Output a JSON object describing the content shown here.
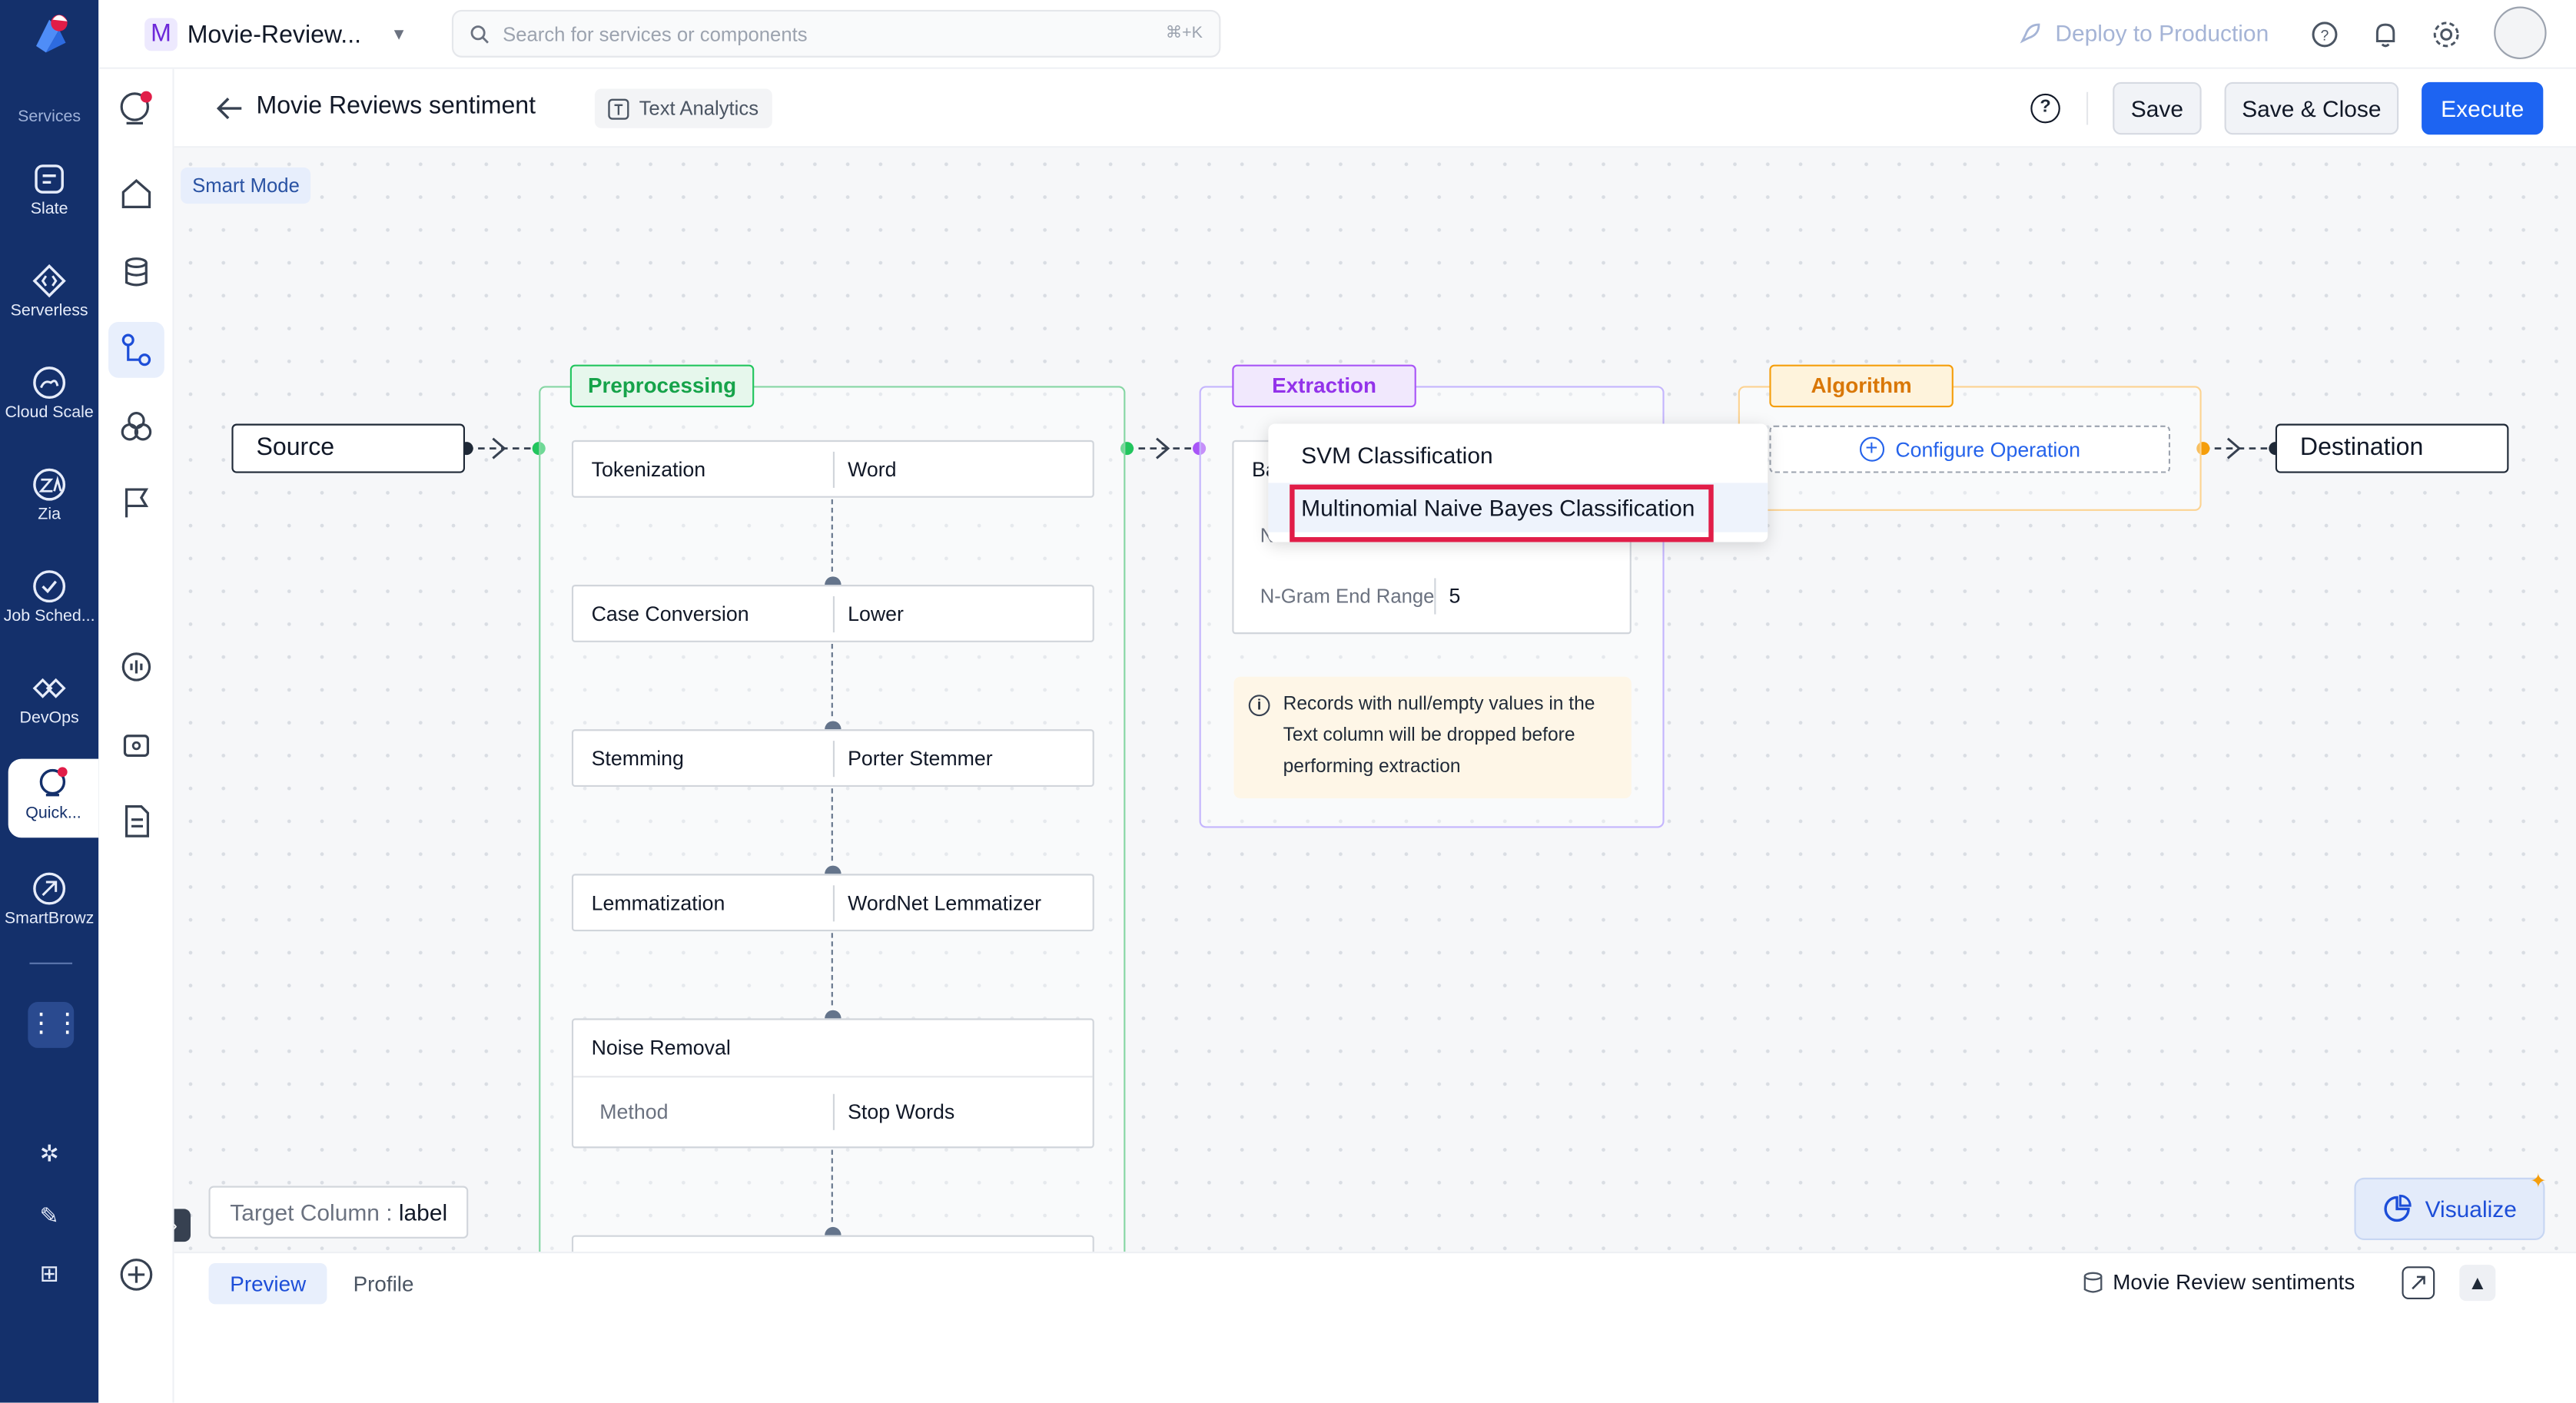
{
  "rail": {
    "header": "Services",
    "items": [
      {
        "label": "Slate",
        "icon": "slate-icon"
      },
      {
        "label": "Serverless",
        "icon": "serverless-icon"
      },
      {
        "label": "Cloud Scale",
        "icon": "cloud-scale-icon"
      },
      {
        "label": "Zia",
        "icon": "zia-icon"
      },
      {
        "label": "Job Sched...",
        "icon": "job-scheduler-icon"
      },
      {
        "label": "DevOps",
        "icon": "devops-icon"
      },
      {
        "label": "Quick...",
        "icon": "quickml-icon"
      },
      {
        "label": "SmartBrowz",
        "icon": "smartbrowz-icon"
      }
    ]
  },
  "topbar": {
    "project_letter": "M",
    "project_name": "Movie-Review...",
    "search_placeholder": "Search for services or components",
    "search_shortcut": "⌘+K",
    "deploy_label": "Deploy to Production"
  },
  "subheader": {
    "title": "Movie Reviews sentiment",
    "tag": "Text Analytics",
    "save": "Save",
    "save_close": "Save & Close",
    "execute": "Execute"
  },
  "canvas": {
    "smart_mode": "Smart Mode",
    "source": "Source",
    "destination": "Destination",
    "preprocessing": {
      "label": "Preprocessing",
      "steps": [
        {
          "name": "Tokenization",
          "value": "Word"
        },
        {
          "name": "Case Conversion",
          "value": "Lower"
        },
        {
          "name": "Stemming",
          "value": "Porter Stemmer"
        },
        {
          "name": "Lemmatization",
          "value": "WordNet Lemmatizer"
        }
      ],
      "noise": {
        "name": "Noise Removal",
        "method_label": "Method",
        "method_value": "Stop Words"
      }
    },
    "extraction": {
      "label": "Extraction",
      "partial_title": "Ba",
      "partial_field": "N",
      "ngram_end_label": "N-Gram End Range",
      "ngram_end_value": "5",
      "info": "Records with null/empty values in the Text column will be dropped before performing extraction"
    },
    "algorithm": {
      "label": "Algorithm",
      "configure": "Configure Operation"
    },
    "dropdown": [
      "SVM Classification",
      "Multinomial Naive Bayes Classification"
    ],
    "target_column_label": "Target Column :",
    "target_column_value": "label",
    "visualize": "Visualize"
  },
  "bottombar": {
    "tabs": [
      "Preview",
      "Profile"
    ],
    "dataset": "Movie Review sentiments"
  },
  "colors": {
    "rail": "#14306b",
    "primary": "#1d64f2",
    "preprocessing": "#22c55e",
    "extraction": "#a855f7",
    "algorithm": "#f59e0b",
    "highlight": "#e11d48"
  }
}
